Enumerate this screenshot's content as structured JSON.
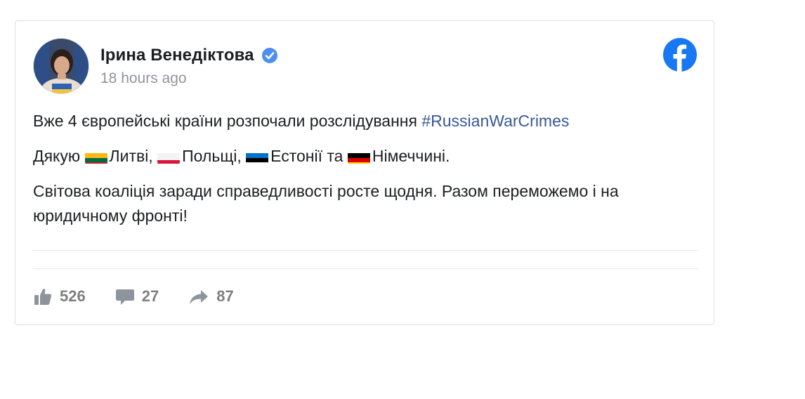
{
  "post": {
    "author_name": "Ірина Венедіктова",
    "timestamp": "18 hours ago",
    "paragraph_1_text": "Вже 4 європейські країни розпочали розслідування ",
    "hashtag": "#RussianWarCrimes",
    "paragraph_2": {
      "thanks": "Дякую ",
      "lithuania": "Литві, ",
      "poland": "Польщі, ",
      "estonia": "Естонії та ",
      "germany": "Німеччині."
    },
    "paragraph_3_text": "Світова коаліція заради справедливості росте щодня. Разом переможемо і на юридичному фронті!"
  },
  "stats": {
    "likes": "526",
    "comments": "27",
    "shares": "87"
  },
  "icons": {
    "verified": "verified-badge-icon",
    "logo": "facebook-logo-icon",
    "like": "thumbs-up-icon",
    "comment": "comment-icon",
    "share": "share-arrow-icon"
  },
  "colors": {
    "brand": "#1877f2",
    "hashtag": "#385898",
    "muted": "#90949c",
    "stat_gray": "#7f7f7f"
  }
}
